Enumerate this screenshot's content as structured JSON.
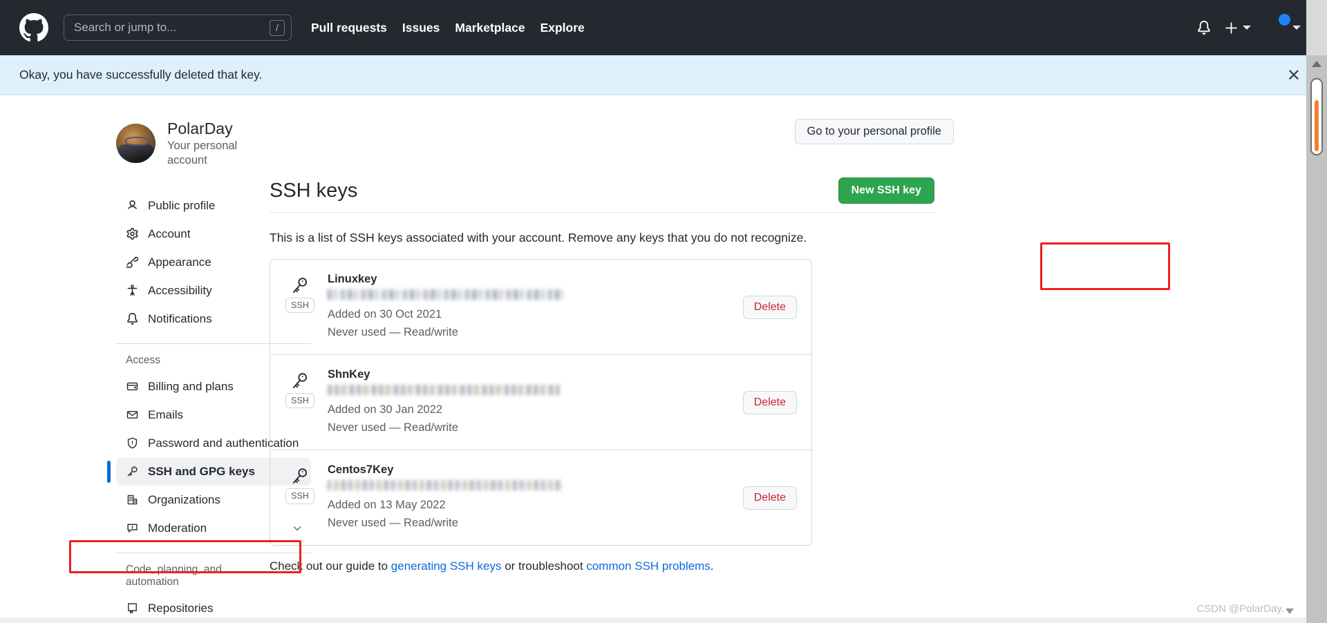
{
  "header": {
    "logo_icon": "github-mark-icon",
    "search": {
      "placeholder": "Search or jump to...",
      "shortcut_key": "/"
    },
    "nav": [
      {
        "label": "Pull requests"
      },
      {
        "label": "Issues"
      },
      {
        "label": "Marketplace"
      },
      {
        "label": "Explore"
      }
    ],
    "notifications_icon": "bell-icon",
    "create_new_icon": "plus-icon",
    "avatar_icon": "user-avatar",
    "background_color": "#24292f"
  },
  "flash": {
    "message": "Okay, you have successfully deleted that key.",
    "close_icon": "close-icon",
    "background_color": "#ddf0fb"
  },
  "sidebar": {
    "profile": {
      "name": "PolarDay",
      "subtitle": "Your personal account",
      "avatar_icon": "profile-avatar"
    },
    "items": [
      {
        "label": "Public profile",
        "icon": "person-icon"
      },
      {
        "label": "Account",
        "icon": "gear-icon"
      },
      {
        "label": "Appearance",
        "icon": "paintbrush-icon"
      },
      {
        "label": "Accessibility",
        "icon": "accessibility-icon"
      },
      {
        "label": "Notifications",
        "icon": "bell-icon"
      }
    ],
    "access_group": {
      "title": "Access",
      "items": [
        {
          "label": "Billing and plans",
          "icon": "credit-card-icon"
        },
        {
          "label": "Emails",
          "icon": "mail-icon"
        },
        {
          "label": "Password and authentication",
          "icon": "shield-lock-icon"
        },
        {
          "label": "SSH and GPG keys",
          "icon": "key-icon",
          "active": true
        },
        {
          "label": "Organizations",
          "icon": "organization-icon"
        },
        {
          "label": "Moderation",
          "icon": "report-icon",
          "has_chevron": true
        }
      ]
    },
    "code_group": {
      "title": "Code, planning, and automation",
      "items": [
        {
          "label": "Repositories",
          "icon": "repo-icon"
        }
      ]
    }
  },
  "main": {
    "personal_profile_button": "Go to your personal profile",
    "page_title": "SSH keys",
    "new_key_button": "New SSH key",
    "lead_text": "This is a list of SSH keys associated with your account. Remove any keys that you do not recognize.",
    "ssh_tag_label": "SSH",
    "delete_label": "Delete",
    "keys": [
      {
        "title": "Linuxkey",
        "fingerprint_redacted": true,
        "added": "Added on 30 Oct 2021",
        "usage": "Never used — Read/write"
      },
      {
        "title": "ShnKey",
        "fingerprint_redacted": true,
        "added": "Added on 30 Jan 2022",
        "usage": "Never used — Read/write"
      },
      {
        "title": "Centos7Key",
        "fingerprint_redacted": true,
        "added": "Added on 13 May 2022",
        "usage": "Never used — Read/write"
      }
    ],
    "footer": {
      "prefix": "Check out our guide to ",
      "link1": "generating SSH keys",
      "middle": " or troubleshoot ",
      "link2": "common SSH problems",
      "suffix": "."
    }
  },
  "annotations": {
    "color": "#ef1f1f",
    "boxes": [
      "sidebar-ssh-and-gpg-keys",
      "new-ssh-key-button"
    ]
  },
  "watermark": {
    "text": "CSDN @PolarDay."
  },
  "colors": {
    "accent_green": "#2da44e",
    "link_blue": "#0969da",
    "danger_red": "#cf222e",
    "header_dark": "#24292f"
  }
}
